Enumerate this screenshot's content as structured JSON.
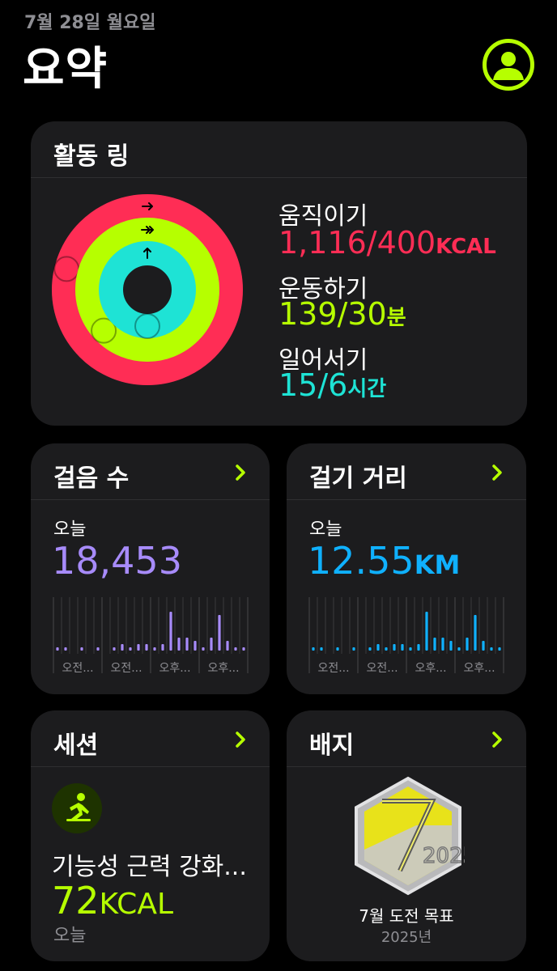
{
  "header": {
    "date": "7월 28일 월요일",
    "title": "요약"
  },
  "rings": {
    "title": "활동 링",
    "move": {
      "label": "움직이기",
      "value": "1,116/400",
      "unit": "KCAL",
      "progress": 2.79,
      "color": "#ff2d55"
    },
    "exercise": {
      "label": "운동하기",
      "value": "139/30",
      "unit": "분",
      "progress": 4.63,
      "color": "#b6ff00"
    },
    "stand": {
      "label": "일어서기",
      "value": "15/6",
      "unit": "시간",
      "progress": 2.5,
      "color": "#1ee3d5"
    }
  },
  "steps": {
    "title": "걸음 수",
    "today_label": "오늘",
    "value": "18,453",
    "color": "#a78bfa",
    "bars": [
      1,
      1,
      0,
      1,
      0,
      1,
      0,
      1,
      2,
      1,
      2,
      2,
      1,
      2,
      12,
      4,
      4,
      3,
      1,
      4,
      11,
      3,
      1,
      1
    ],
    "axis_labels": [
      "오전...",
      "오전...",
      "오후...",
      "오후..."
    ]
  },
  "distance": {
    "title": "걸기 거리",
    "today_label": "오늘",
    "value": "12.55",
    "unit": "KM",
    "color": "#0fb1ff",
    "bars": [
      1,
      1,
      0,
      1,
      0,
      1,
      0,
      1,
      2,
      1,
      2,
      2,
      1,
      2,
      12,
      4,
      4,
      3,
      1,
      4,
      11,
      3,
      1,
      1
    ],
    "axis_labels": [
      "오전...",
      "오전...",
      "오후...",
      "오후..."
    ]
  },
  "session": {
    "title": "세션",
    "name": "기능성 근력 강화...",
    "value": "72",
    "unit": "KCAL",
    "when": "오늘"
  },
  "badge": {
    "title": "배지",
    "name": "7월 도전 목표",
    "year": "2025년"
  }
}
